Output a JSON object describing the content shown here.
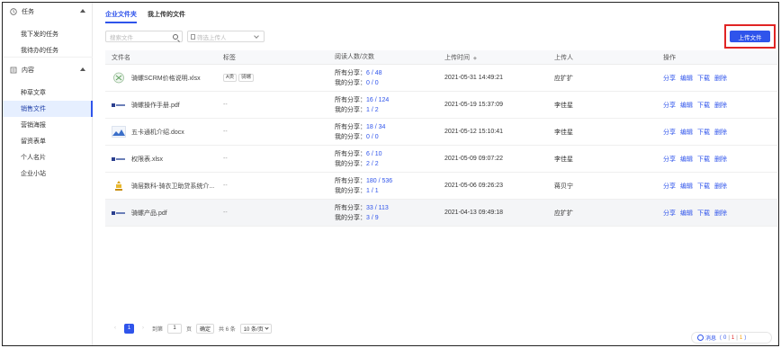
{
  "sidebar": {
    "groups": [
      {
        "label": "任务",
        "icon": "clock-icon",
        "items": [
          "我下发的任务",
          "我待办的任务"
        ]
      },
      {
        "label": "内容",
        "icon": "content-icon",
        "items": [
          "种草文章",
          "销售文件",
          "营销海报",
          "留资表单",
          "个人名片",
          "企业小站"
        ]
      }
    ],
    "active_item": "销售文件"
  },
  "tabs": [
    {
      "label": "企业文件夹",
      "active": true
    },
    {
      "label": "我上传的文件",
      "active": false
    }
  ],
  "toolbar": {
    "search_placeholder": "搜索文件",
    "uploader_placeholder": "筛选上传人",
    "upload_label": "上传文件"
  },
  "table": {
    "headers": [
      "文件名",
      "标签",
      "阅读人数/次数",
      "上传时间",
      "上传人",
      "操作"
    ],
    "rows": [
      {
        "name": "骑螺SCRM价格说明.xlsx",
        "icon": "excel-file-icon",
        "tags": [
          "A类",
          "骑螺"
        ],
        "all_share_prefix": "所有分享：",
        "all_share": "6 / 48",
        "my_share_prefix": "我的分享：",
        "my_share": "0 / 0",
        "time": "2021-05-31 14:49:21",
        "uploader": "应扩扩"
      },
      {
        "name": "骑螺操作手册.pdf",
        "icon": "pdf-file-icon",
        "tags": [],
        "tag_empty": "--",
        "all_share_prefix": "所有分享：",
        "all_share": "16 / 124",
        "my_share_prefix": "我的分享：",
        "my_share": "1 / 2",
        "time": "2021-05-19 15:37:09",
        "uploader": "李佳星"
      },
      {
        "name": "五卡通机介绍.docx",
        "icon": "word-file-icon",
        "tags": [],
        "tag_empty": "--",
        "all_share_prefix": "所有分享：",
        "all_share": "18 / 34",
        "my_share_prefix": "我的分享：",
        "my_share": "0 / 0",
        "time": "2021-05-12 15:10:41",
        "uploader": "李佳星"
      },
      {
        "name": "权限表.xlsx",
        "icon": "excel-file-icon",
        "tags": [],
        "tag_empty": "--",
        "all_share_prefix": "所有分享：",
        "all_share": "6 / 10",
        "my_share_prefix": "我的分享：",
        "my_share": "2 / 2",
        "time": "2021-05-09 09:07:22",
        "uploader": "李佳星"
      },
      {
        "name": "骑层数科-骑衣卫助贷系统介...",
        "icon": "ppt-file-icon",
        "tags": [],
        "tag_empty": "--",
        "all_share_prefix": "所有分享：",
        "all_share": "180 / 536",
        "my_share_prefix": "我的分享：",
        "my_share": "1 / 1",
        "time": "2021-05-06 09:26:23",
        "uploader": "蒋贝宁"
      },
      {
        "name": "骑螺产品.pdf",
        "icon": "pdf-file-icon",
        "tags": [],
        "tag_empty": "--",
        "all_share_prefix": "所有分享：",
        "all_share": "33 / 113",
        "my_share_prefix": "我的分享：",
        "my_share": "3 / 9",
        "time": "2021-04-13 09:49:18",
        "uploader": "应扩扩"
      }
    ],
    "ops": [
      "分享",
      "编辑",
      "下载",
      "删除"
    ]
  },
  "pagination": {
    "current_page": "1",
    "goto_label": "到第",
    "goto_value": "1",
    "page_unit": "页",
    "confirm_label": "确定",
    "total_label": "共 6 条",
    "page_size": "10 条/页"
  },
  "message_bar": {
    "label": "消息（",
    "count_blue": "0",
    "sep1": "|",
    "count_red": "1",
    "sep2": "|",
    "count_orange": "1",
    "end": "）"
  },
  "colors": {
    "accent": "#2f54eb",
    "highlight_border": "#e02424",
    "active_bg": "#e6efff"
  }
}
